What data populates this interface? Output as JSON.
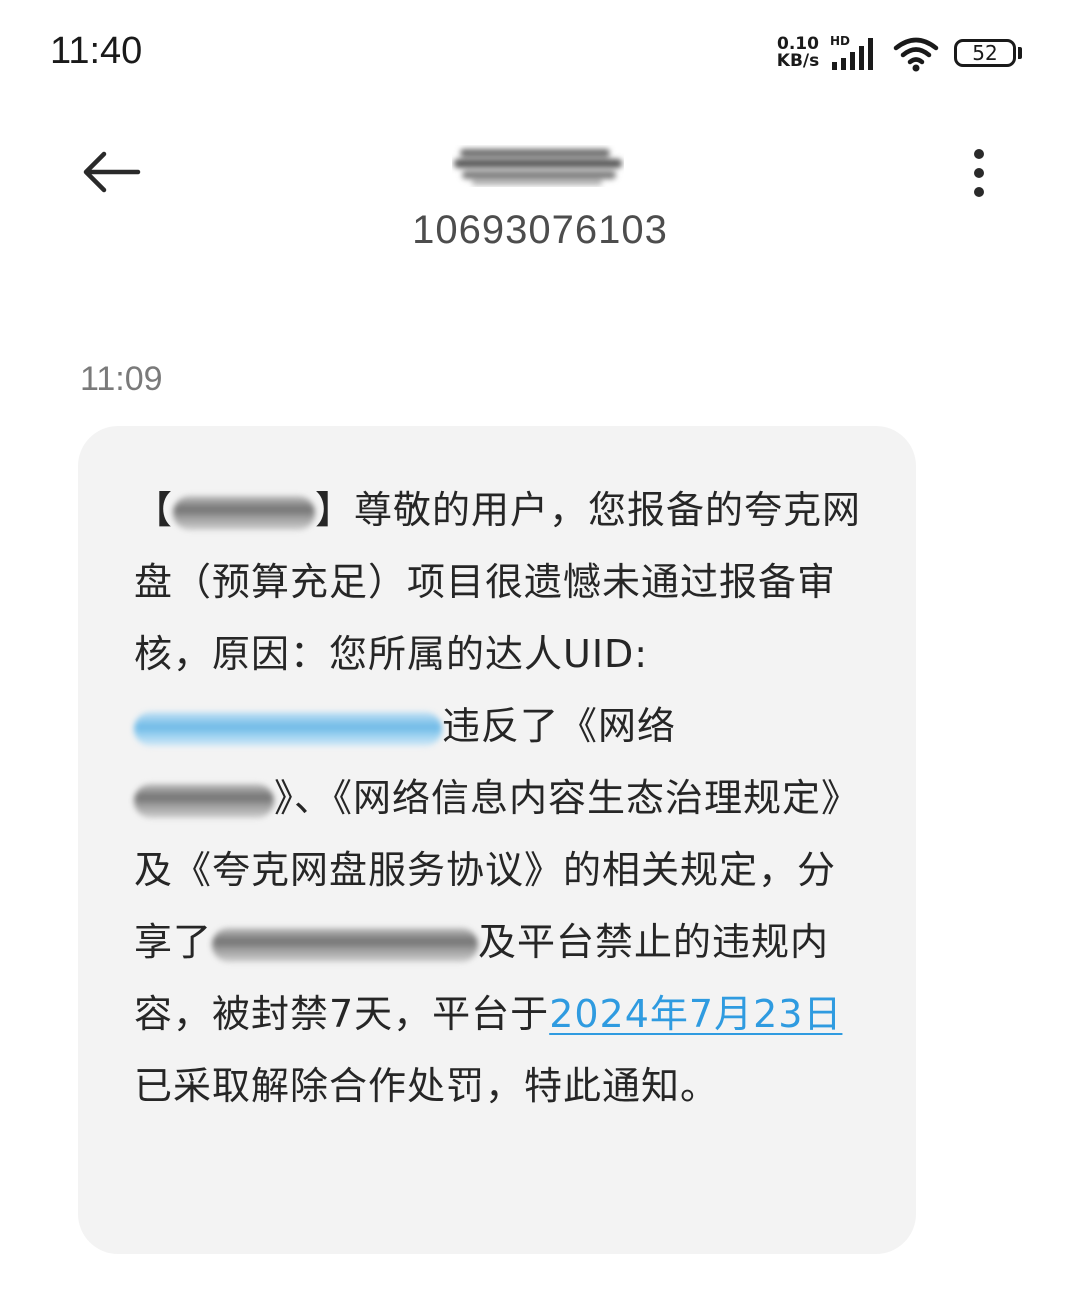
{
  "status_bar": {
    "time": "11:40",
    "net_speed_value": "0.10",
    "net_speed_unit": "KB/s",
    "signal_label": "HD",
    "battery_level": "52"
  },
  "header": {
    "back_icon": "back-arrow-icon",
    "contact_number": "10693076103",
    "more_icon": "more-vert-icon"
  },
  "message": {
    "time": "11:09",
    "segments": {
      "open_bracket": "【",
      "close_bracket_and_greeting": "】尊敬的用户，您报备的夸克网盘（预算充足）项目很遗憾未通过报备审核，原因：您所属的达人UID:",
      "after_uid": "违反了《网络",
      "after_law_name": "》、《网络信息内容生态治理规定》及《夸克网盘服务协议》的相关规定，分享了",
      "after_shared": "及平台禁止的违规内容，被封禁7天，平台于",
      "date_link": "2024年7月23日",
      "ending": "已采取解除合作处罚，特此通知。"
    }
  },
  "colors": {
    "bubble_bg": "#f3f3f3",
    "link": "#2f9be0",
    "timestamp": "#7a7a7a"
  }
}
